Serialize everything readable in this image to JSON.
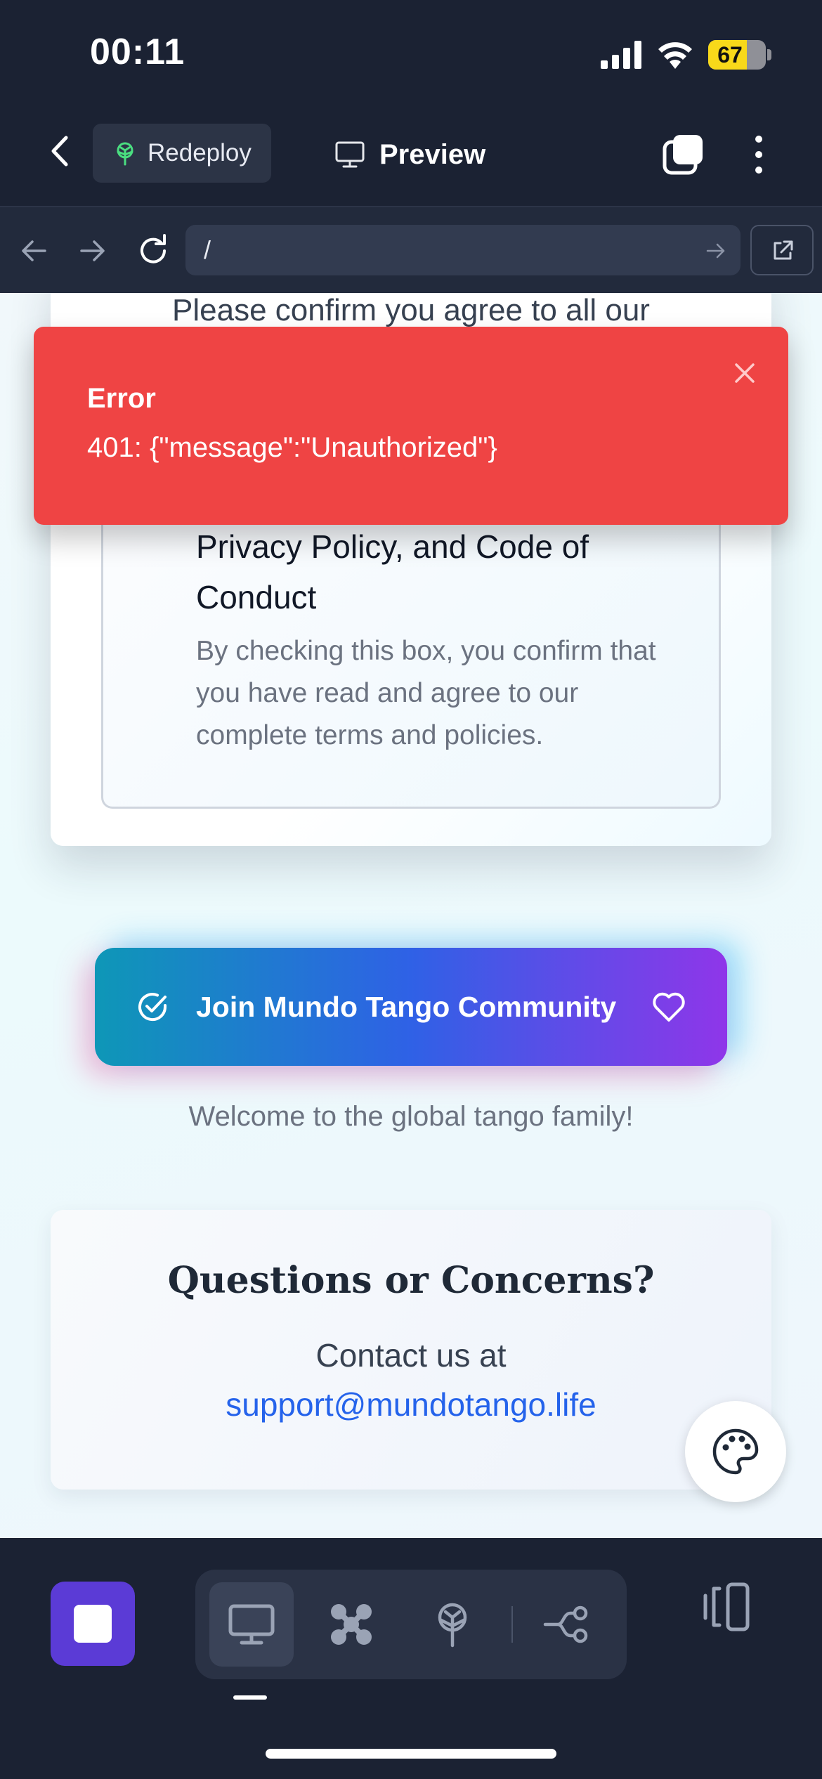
{
  "status_bar": {
    "time": "00:11",
    "battery": "67",
    "battery_level": 0.67
  },
  "header": {
    "redeploy_label": "Redeploy",
    "preview_label": "Preview"
  },
  "browser": {
    "url": "/"
  },
  "content": {
    "top_text": "Please confirm you agree to all our",
    "policy_title": "Privacy Policy, and Code of Conduct",
    "policy_description": "By checking this box, you confirm that you have read and agree to our complete terms and policies.",
    "join_label": "Join Mundo Tango Community",
    "welcome": "Welcome to the global tango family!",
    "contact_title": "Questions or Concerns?",
    "contact_text": "Contact us at",
    "contact_email": "support@mundotango.life"
  },
  "error_toast": {
    "title": "Error",
    "message": "401: {\"message\":\"Unauthorized\"}"
  },
  "colors": {
    "error": "#ef4444",
    "accent": "#5b3bd6",
    "link": "#2563eb",
    "background": "#1b2233"
  }
}
